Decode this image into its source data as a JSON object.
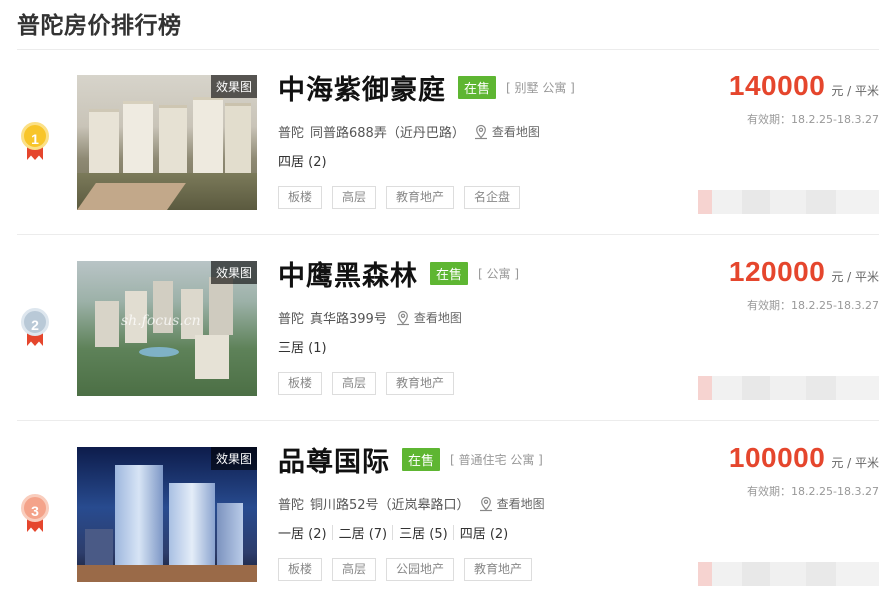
{
  "page": {
    "title": "普陀房价排行榜"
  },
  "listings": [
    {
      "rank": "1",
      "name": "中海紫御豪庭",
      "status": "在售",
      "types": "[ 别墅 公寓 ]",
      "district": "普陀",
      "address": "同普路688弄（近丹巴路）",
      "map_label": "查看地图",
      "rooms": [
        "四居 (2)"
      ],
      "tags": [
        "板楼",
        "高层",
        "教育地产",
        "名企盘"
      ],
      "price": "140000",
      "unit": "元 / 平米",
      "valid": "有效期：18.2.25-18.3.27",
      "image_badge": "效果图",
      "watermark": ""
    },
    {
      "rank": "2",
      "name": "中鹰黑森林",
      "status": "在售",
      "types": "[ 公寓 ]",
      "district": "普陀",
      "address": "真华路399号",
      "map_label": "查看地图",
      "rooms": [
        "三居 (1)"
      ],
      "tags": [
        "板楼",
        "高层",
        "教育地产"
      ],
      "price": "120000",
      "unit": "元 / 平米",
      "valid": "有效期：18.2.25-18.3.27",
      "image_badge": "效果图",
      "watermark": "sh.focus.cn"
    },
    {
      "rank": "3",
      "name": "品尊国际",
      "status": "在售",
      "types": "[ 普通住宅 公寓 ]",
      "district": "普陀",
      "address": "铜川路52号（近岚皋路口）",
      "map_label": "查看地图",
      "rooms": [
        "一居 (2)",
        "二居 (7)",
        "三居 (5)",
        "四居 (2)"
      ],
      "tags": [
        "板楼",
        "高层",
        "公园地产",
        "教育地产"
      ],
      "price": "100000",
      "unit": "元 / 平米",
      "valid": "有效期：18.2.25-18.3.27",
      "image_badge": "效果图",
      "watermark": ""
    }
  ],
  "colors": {
    "price": "#e5462d",
    "status": "#5eb632",
    "title": "#333333"
  },
  "icons": {
    "map": "map-pin-icon"
  }
}
